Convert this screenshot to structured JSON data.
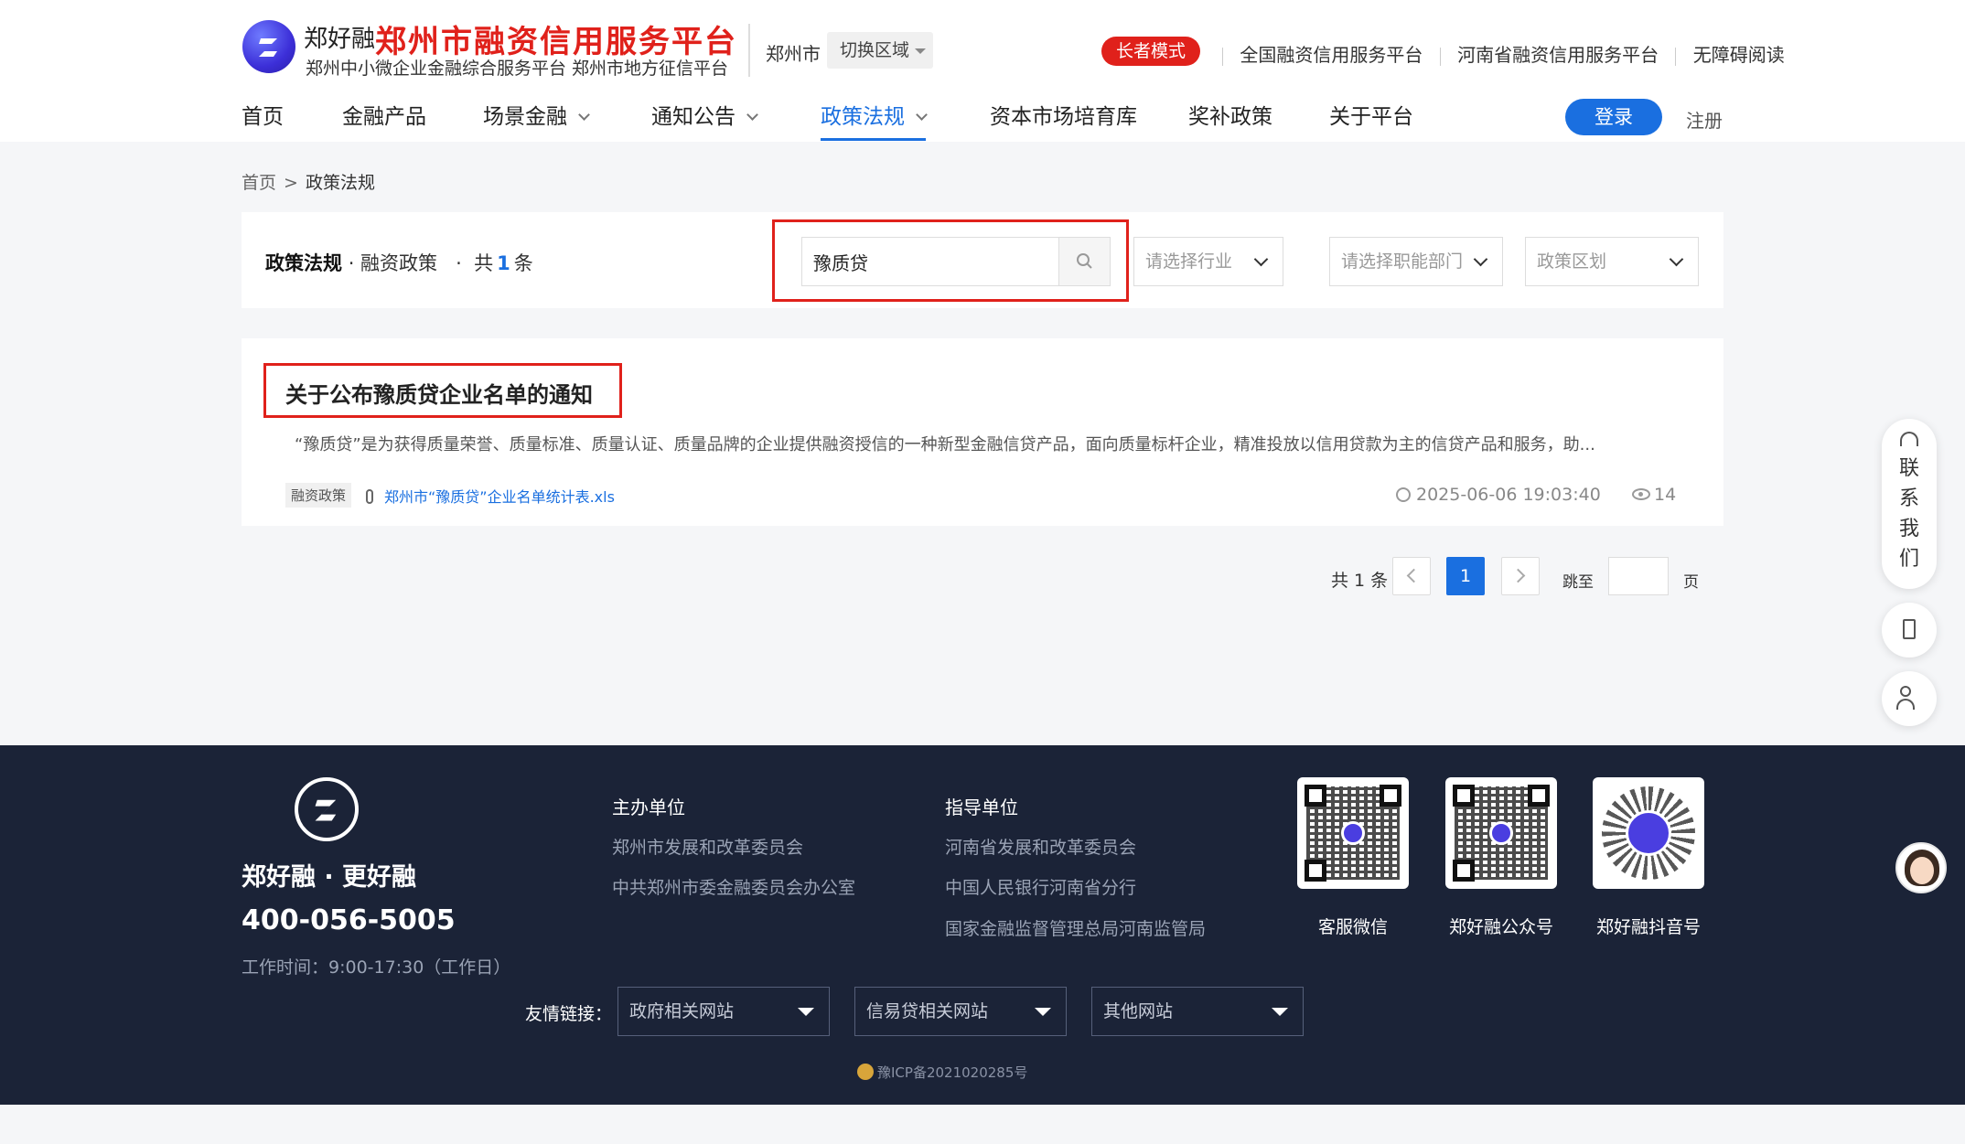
{
  "header": {
    "brand_small": "郑好融",
    "brand_name": "郑州市融资信用服务平台",
    "brand_sub": "郑州中小微企业金融综合服务平台 郑州市地方征信平台",
    "city": "郑州市",
    "switch_area": "切换区域",
    "elder_mode": "长者模式",
    "top_links": [
      "全国融资信用服务平台",
      "河南省融资信用服务平台",
      "无障碍阅读"
    ]
  },
  "nav": {
    "items": [
      {
        "label": "首页",
        "has_dropdown": false,
        "active": false
      },
      {
        "label": "金融产品",
        "has_dropdown": false,
        "active": false
      },
      {
        "label": "场景金融",
        "has_dropdown": true,
        "active": false
      },
      {
        "label": "通知公告",
        "has_dropdown": true,
        "active": false
      },
      {
        "label": "政策法规",
        "has_dropdown": true,
        "active": true
      },
      {
        "label": "资本市场培育库",
        "has_dropdown": false,
        "active": false
      },
      {
        "label": "奖补政策",
        "has_dropdown": false,
        "active": false
      },
      {
        "label": "关于平台",
        "has_dropdown": false,
        "active": false
      }
    ],
    "login": "登录",
    "register": "注册"
  },
  "breadcrumb": {
    "home": "首页",
    "sep": ">",
    "current": "政策法规"
  },
  "filter": {
    "title": "政策法规",
    "subtitle": "· 融资政策",
    "dot": "·",
    "total_prefix": "共",
    "total_count": "1",
    "total_suffix": "条",
    "search_value": "豫质贷",
    "industry_placeholder": "请选择行业",
    "department_placeholder": "请选择职能部门",
    "region_placeholder": "政策区划"
  },
  "result": {
    "title": "关于公布豫质贷企业名单的通知",
    "description": "“豫质贷”是为获得质量荣誉、质量标准、质量认证、质量品牌的企业提供融资授信的一种新型金融信贷产品，面向质量标杆企业，精准投放以信用贷款为主的信贷产品和服务，助...",
    "tag": "融资政策",
    "attachment": "郑州市“豫质贷”企业名单统计表.xls",
    "time": "2025-06-06 19:03:40",
    "views": "14"
  },
  "pager": {
    "total": "共 1 条",
    "current_page": "1",
    "jump_label": "跳至",
    "page_label": "页"
  },
  "side": {
    "contact_chars": [
      "联",
      "系",
      "我",
      "们"
    ]
  },
  "footer": {
    "slogan": "郑好融 · 更好融",
    "phone": "400-056-5005",
    "hours": "工作时间：9:00-17:30（工作日）",
    "host_title": "主办单位",
    "host_links": [
      "郑州市发展和改革委员会",
      "中共郑州市委金融委员会办公室"
    ],
    "guide_title": "指导单位",
    "guide_links": [
      "河南省发展和改革委员会",
      "中国人民银行河南省分行",
      "国家金融监督管理总局河南监管局"
    ],
    "qr_labels": [
      "客服微信",
      "郑好融公众号",
      "郑好融抖音号"
    ],
    "friend_label": "友情链接：",
    "friend_selects": [
      "政府相关网站",
      "信易贷相关网站",
      "其他网站"
    ],
    "icp": "豫ICP备2021020285号"
  },
  "colors": {
    "brand_red": "#e0211b",
    "primary_blue": "#1a6fe0",
    "footer_bg": "#1b2337",
    "page_bg": "#f5f6f8"
  }
}
